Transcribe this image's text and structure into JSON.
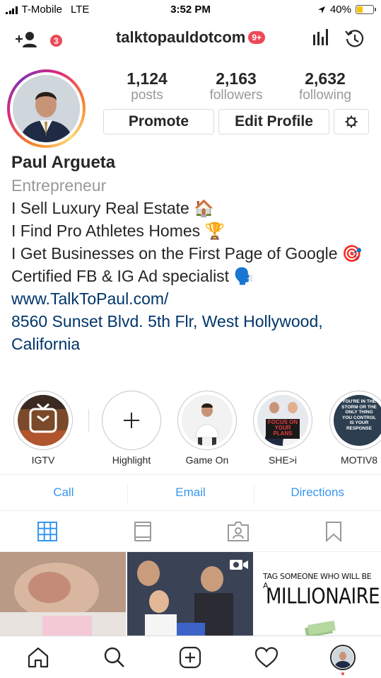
{
  "status_bar": {
    "carrier": "T-Mobile",
    "network": "LTE",
    "time": "3:52 PM",
    "battery": "40%",
    "battery_level": 0.4
  },
  "header": {
    "notification_count": "3",
    "username": "talktopauldotcom",
    "message_badge": "9+"
  },
  "profile": {
    "stats": [
      {
        "value": "1,124",
        "label": "posts"
      },
      {
        "value": "2,163",
        "label": "followers"
      },
      {
        "value": "2,632",
        "label": "following"
      }
    ],
    "promote_label": "Promote",
    "edit_profile_label": "Edit Profile",
    "name": "Paul Argueta",
    "category": "Entrepreneur",
    "bio_lines": [
      "I Sell Luxury Real Estate 🏠",
      "I Find Pro Athletes Homes 🏆",
      "I Get Businesses on the First Page of Google 🎯",
      "Certified FB & IG Ad specialist 🗣️"
    ],
    "website": "www.TalkToPaul.com/",
    "address": "8560 Sunset Blvd. 5th Flr, West Hollywood, California"
  },
  "highlights": [
    {
      "label": "IGTV"
    },
    {
      "label": "Highlight"
    },
    {
      "label": "Game On"
    },
    {
      "label": "SHE>i"
    },
    {
      "label": "MOTIV8"
    }
  ],
  "highlight_texts": {
    "she_sign": "FOCUS ON YOUR PLANS",
    "motiv8": "YOU'RE IN THE STORM OR THE ONLY THING YOU CONTROL IS YOUR RESPONSE"
  },
  "contact": {
    "call": "Call",
    "email": "Email",
    "directions": "Directions"
  },
  "grid_texts": {
    "post3_line1": "TAG SOMEONE WHO WILL BE A",
    "post3_line2": "MILLIONAIRE"
  },
  "icons": {
    "header": [
      "add-user-icon",
      "insights-icon",
      "archive-icon"
    ],
    "tabs": [
      "grid-icon",
      "igtv-icon",
      "tagged-icon",
      "saved-icon"
    ],
    "bottom_nav": [
      "home-icon",
      "search-icon",
      "new-post-icon",
      "activity-icon",
      "profile-avatar"
    ]
  },
  "colors": {
    "link": "#003569",
    "action": "#3897f0",
    "badge": "#ed4956",
    "muted": "#999999"
  }
}
